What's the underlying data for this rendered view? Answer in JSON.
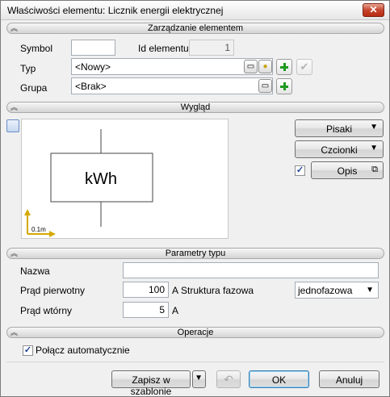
{
  "window": {
    "title": "Właściwości elementu: Licznik energii elektrycznej",
    "close_glyph": "✕"
  },
  "sections": {
    "management": "Zarządzanie elementem",
    "appearance": "Wygląd",
    "type_params": "Parametry typu",
    "operations": "Operacje"
  },
  "management": {
    "symbol_label": "Symbol",
    "symbol_value": "",
    "id_label": "Id elementu",
    "id_value": "1",
    "type_label": "Typ",
    "type_value": "<Nowy>",
    "group_label": "Grupa",
    "group_value": "<Brak>"
  },
  "preview": {
    "symbol_text": "kWh",
    "scale_label": "0.1m"
  },
  "appearance": {
    "pens_button": "Pisaki",
    "fonts_button": "Czcionki",
    "description_checked": true,
    "description_button": "Opis"
  },
  "type_params": {
    "name_label": "Nazwa",
    "name_value": "",
    "primary_current_label": "Prąd pierwotny",
    "primary_current_value": "100",
    "primary_current_unit": "A",
    "phase_structure_label": "Struktura fazowa",
    "phase_structure_value": "jednofazowa",
    "secondary_current_label": "Prąd wtórny",
    "secondary_current_value": "5",
    "secondary_current_unit": "A"
  },
  "operations": {
    "auto_connect_label": "Połącz automatycznie",
    "auto_connect_checked": true
  },
  "footer": {
    "save_template": "Zapisz w szablonie",
    "ok": "OK",
    "cancel": "Anuluj"
  },
  "colors": {
    "accent_green": "#1f9a1f",
    "scale_arrow": "#d4a900"
  }
}
